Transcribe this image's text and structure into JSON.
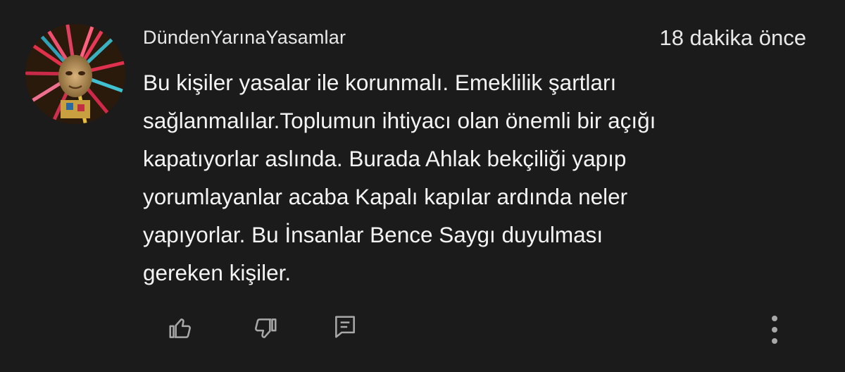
{
  "comment": {
    "author": "DündenYarınaYasamlar",
    "timestamp": "18 dakika önce",
    "text_lines": [
      "Bu kişiler yasalar ile korunmalı. Emeklilik şartları",
      "sağlanmalılar.Toplumun ihtiyacı olan önemli bir açığı",
      "kapatıyorlar aslında. Burada Ahlak bekçiliği yapıp",
      "yorumlayanlar acaba Kapalı kapılar ardında neler",
      "yapıyorlar. Bu İnsanlar Bence Saygı duyulması",
      "gereken kişiler."
    ]
  },
  "actions": {
    "like_icon": "thumbs-up-icon",
    "dislike_icon": "thumbs-down-icon",
    "reply_icon": "reply-comment-icon",
    "more_icon": "more-vertical-icon"
  },
  "colors": {
    "background": "#1b1b1b",
    "text": "#f1f1f1",
    "icon": "#a8a8a8"
  }
}
